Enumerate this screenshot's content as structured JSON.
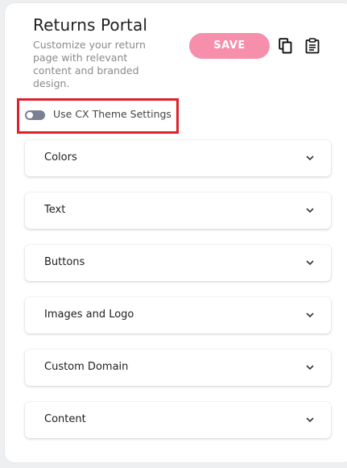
{
  "header": {
    "title": "Returns Portal",
    "subtitle": "Customize your return page with relevant content and branded design."
  },
  "toolbar": {
    "save_label": "SAVE",
    "copy_icon": "copy-icon",
    "clipboard_icon": "clipboard-icon",
    "save_color": "#f68fab"
  },
  "theme_toggle": {
    "label": "Use CX Theme Settings",
    "enabled": false,
    "highlight_color": "#e0202a"
  },
  "sections": [
    {
      "label": "Colors",
      "expanded": false
    },
    {
      "label": "Text",
      "expanded": false
    },
    {
      "label": "Buttons",
      "expanded": false
    },
    {
      "label": "Images and Logo",
      "expanded": false
    },
    {
      "label": "Custom Domain",
      "expanded": false
    },
    {
      "label": "Content",
      "expanded": false
    }
  ]
}
